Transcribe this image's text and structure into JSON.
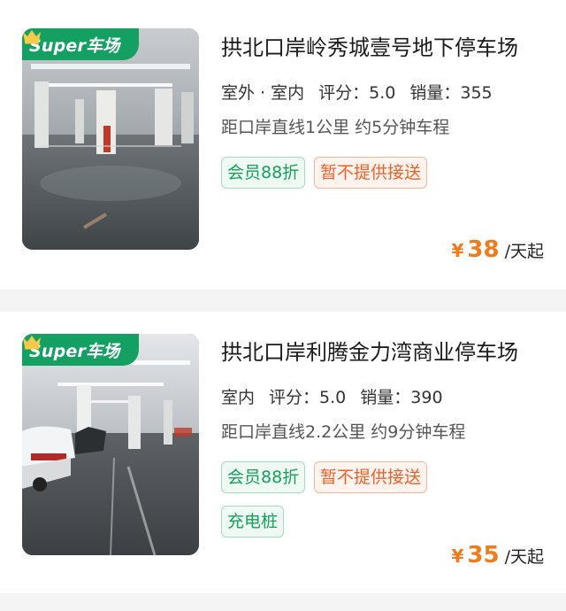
{
  "listings": [
    {
      "badge": "Super车场",
      "title": "拱北口岸岭秀城壹号地下停车场",
      "type": "室外 · 室内",
      "rating_label": "评分：",
      "rating": "5.0",
      "sales_label": "销量：",
      "sales": "355",
      "distance": "距口岸直线1公里 约5分钟车程",
      "tags": [
        "会员88折",
        "暂不提供接送"
      ],
      "price_symbol": "¥",
      "price": "38",
      "price_unit": "/天起"
    },
    {
      "badge": "Super车场",
      "title": "拱北口岸利腾金力湾商业停车场",
      "type": "室内",
      "rating_label": "评分：",
      "rating": "5.0",
      "sales_label": "销量：",
      "sales": "390",
      "distance": "距口岸直线2.2公里 约9分钟车程",
      "tags": [
        "会员88折",
        "暂不提供接送",
        "充电桩"
      ],
      "price_symbol": "¥",
      "price": "35",
      "price_unit": "/天起"
    }
  ],
  "colors": {
    "badge_green": "#14a063",
    "price_orange": "#f27a1a",
    "tag_green": "#16a05a",
    "tag_orange": "#f0612a"
  }
}
